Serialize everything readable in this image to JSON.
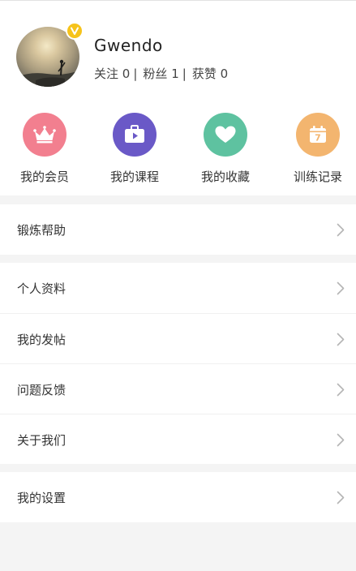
{
  "profile": {
    "username": "Gwendo",
    "stats": [
      {
        "label": "关注",
        "value": "0"
      },
      {
        "label": "粉丝",
        "value": "1"
      },
      {
        "label": "获赞",
        "value": "0"
      }
    ],
    "badge_icon": "verified-v-icon",
    "badge_color": "#f6c31b"
  },
  "shortcuts": [
    {
      "label": "我的会员",
      "icon": "crown-icon",
      "color": "#f27f8f"
    },
    {
      "label": "我的课程",
      "icon": "video-bag-icon",
      "color": "#6a59c7"
    },
    {
      "label": "我的收藏",
      "icon": "heart-icon",
      "color": "#5ec2a0"
    },
    {
      "label": "训练记录",
      "icon": "calendar-icon",
      "color": "#f3b56f",
      "icon_text": "7"
    }
  ],
  "menu_groups": [
    {
      "items": [
        {
          "label": "锻炼帮助"
        }
      ]
    },
    {
      "items": [
        {
          "label": "个人资料"
        },
        {
          "label": "我的发帖"
        },
        {
          "label": "问题反馈"
        },
        {
          "label": "关于我们"
        }
      ]
    },
    {
      "items": [
        {
          "label": "我的设置"
        }
      ]
    }
  ],
  "colors": {
    "background": "#f4f4f4",
    "card": "#ffffff",
    "chevron": "#b5b5b5"
  }
}
